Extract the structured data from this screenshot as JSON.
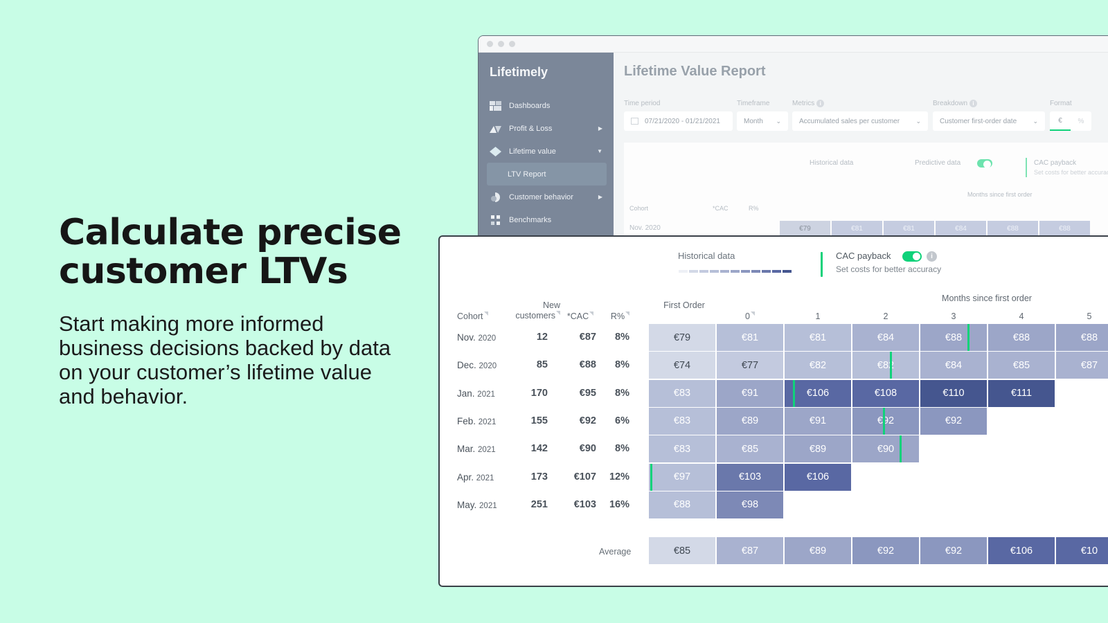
{
  "hero": {
    "title": "Calculate precise customer LTVs",
    "subtitle": "Start making more informed business decisions backed by data on your customer’s lifetime value and behavior."
  },
  "app": {
    "brand": "Lifetimely",
    "nav": [
      {
        "label": "Dashboards",
        "icon": "dashboard-icon",
        "arrow": ""
      },
      {
        "label": "Profit & Loss",
        "icon": "profit-loss-icon",
        "arrow": "▶"
      },
      {
        "label": "Lifetime value",
        "icon": "diamond-icon",
        "arrow": "▼"
      },
      {
        "label": "LTV Report",
        "icon": "",
        "arrow": "",
        "active": true
      },
      {
        "label": "Customer behavior",
        "icon": "customer-behavior-icon",
        "arrow": "▶"
      },
      {
        "label": "Benchmarks",
        "icon": "benchmarks-icon",
        "arrow": ""
      }
    ],
    "report_title": "Lifetime Value Report",
    "filters": {
      "time_period": {
        "label": "Time period",
        "value": "07/21/2020 - 01/21/2021"
      },
      "timeframe": {
        "label": "Timeframe",
        "value": "Month"
      },
      "metrics": {
        "label": "Metrics",
        "value": "Accumulated sales per customer"
      },
      "breakdown": {
        "label": "Breakdown",
        "value": "Customer first-order date"
      },
      "format": {
        "label": "Format",
        "options": [
          "€",
          "%"
        ],
        "selected": "€"
      }
    },
    "legend": {
      "historical": "Historical data",
      "predictive": "Predictive data",
      "predictive_on": true,
      "cac_payback": "CAC payback",
      "cac_payback_on": true,
      "cac_hint": "Set costs for better accuracy"
    }
  },
  "colors": {
    "background": "#c8fde6",
    "accent_green": "#10d27a",
    "scale": [
      "#edf0f6",
      "#d3d9e7",
      "#c3cadf",
      "#b6bfd8",
      "#a9b2d0",
      "#9ca6c8",
      "#8b97bf",
      "#7d89b6",
      "#6a78ab",
      "#5968a3",
      "#45568f"
    ]
  },
  "table": {
    "headers": {
      "cohort": "Cohort",
      "new_customers": "New customers",
      "cac": "*CAC",
      "r_pct": "R%",
      "first_order": "First Order",
      "months_since": "Months since first order",
      "months": [
        "0",
        "1",
        "2",
        "3",
        "4",
        "5"
      ]
    },
    "rows": [
      {
        "month": "Nov.",
        "year": "2020",
        "new_customers": "12",
        "cac": "€87",
        "r_pct": "8%",
        "values": [
          "€79",
          "€81",
          "€81",
          "€84",
          "€88",
          "€88",
          "€88"
        ],
        "payback_col": 4
      },
      {
        "month": "Dec.",
        "year": "2020",
        "new_customers": "85",
        "cac": "€88",
        "r_pct": "8%",
        "values": [
          "€74",
          "€77",
          "€82",
          "€82",
          "€84",
          "€85",
          "€87"
        ],
        "payback_col": 3
      },
      {
        "month": "Jan.",
        "year": "2021",
        "new_customers": "170",
        "cac": "€95",
        "r_pct": "8%",
        "values": [
          "€83",
          "€91",
          "€106",
          "€108",
          "€110",
          "€111"
        ],
        "payback_col": 2
      },
      {
        "month": "Feb.",
        "year": "2021",
        "new_customers": "155",
        "cac": "€92",
        "r_pct": "6%",
        "values": [
          "€83",
          "€89",
          "€91",
          "€92",
          "€92"
        ],
        "payback_col": 3
      },
      {
        "month": "Mar.",
        "year": "2021",
        "new_customers": "142",
        "cac": "€90",
        "r_pct": "8%",
        "values": [
          "€83",
          "€85",
          "€89",
          "€90"
        ],
        "payback_col": 3
      },
      {
        "month": "Apr.",
        "year": "2021",
        "new_customers": "173",
        "cac": "€107",
        "r_pct": "12%",
        "values": [
          "€97",
          "€103",
          "€106"
        ],
        "payback_col": 0
      },
      {
        "month": "May.",
        "year": "2021",
        "new_customers": "251",
        "cac": "€103",
        "r_pct": "16%",
        "values": [
          "€88",
          "€98"
        ],
        "payback_col": -1
      }
    ],
    "average": {
      "label": "Average",
      "values": [
        "€85",
        "€87",
        "€89",
        "€92",
        "€92",
        "€106",
        "€10"
      ]
    }
  }
}
